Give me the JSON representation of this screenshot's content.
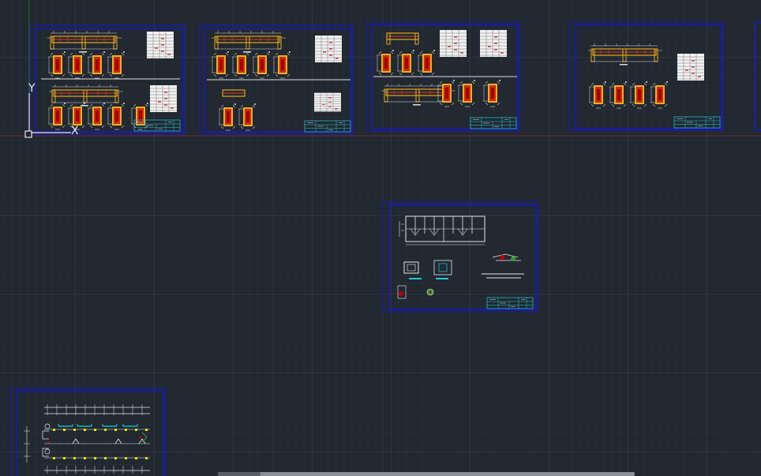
{
  "app": {
    "view": "model-space",
    "background": "#212830",
    "grid_minor": "#2b333c",
    "grid_major": "#38424d",
    "axis_x_color": "#8a2a2a",
    "axis_y_color": "#2a6a2a",
    "ucs_labels": {
      "y": "Y",
      "x": "X"
    }
  },
  "sheets": [
    {
      "name": "sheet-1",
      "content": "beam-elevations-and-column-sections",
      "frame_color": "#1010c8"
    },
    {
      "name": "sheet-2",
      "content": "beam-elevations-and-column-sections",
      "frame_color": "#1010c8"
    },
    {
      "name": "sheet-3",
      "content": "beam-elevations-and-column-sections",
      "frame_color": "#1010c8"
    },
    {
      "name": "sheet-4",
      "content": "beam-elevation-and-column-sections",
      "frame_color": "#1010c8"
    },
    {
      "name": "sheet-5",
      "content": "plan-and-detail-drawings",
      "frame_color": "#1010c8"
    },
    {
      "name": "sheet-6",
      "content": "floor-plan",
      "frame_color": "#1010c8"
    }
  ],
  "colors": {
    "beam": "#e0a020",
    "column_fill": "#e04010",
    "column_core": "#c00000",
    "line": "#e8e8e8",
    "title_block": "#20c8d8",
    "frame": "#1818c8",
    "yellow_dot": "#e8e000"
  }
}
